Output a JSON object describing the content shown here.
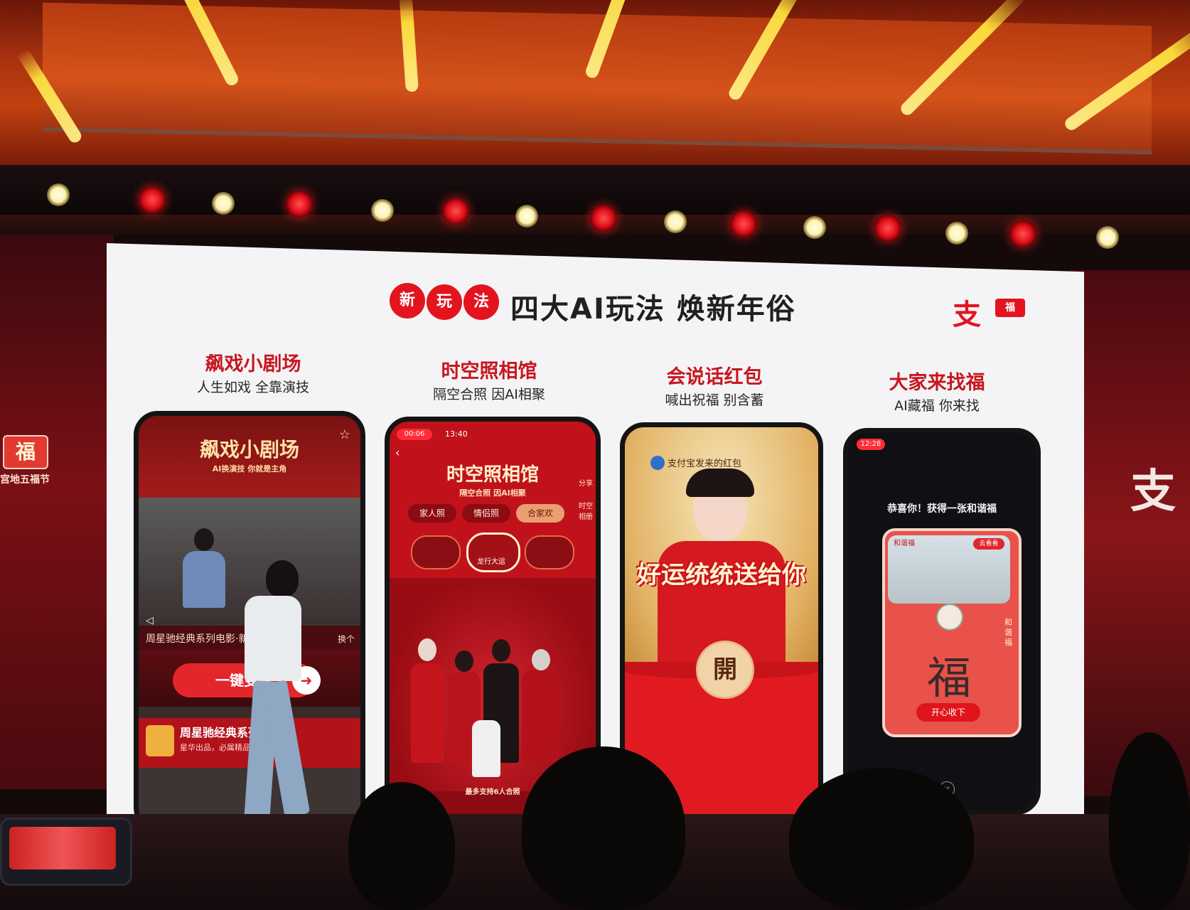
{
  "slide": {
    "badge_chars": [
      "新",
      "玩",
      "法"
    ],
    "title": "四大AI玩法  焕新年俗",
    "brand_mark": "支",
    "brand_mini": "福"
  },
  "columns": [
    {
      "title": "飙戏小剧场",
      "subtitle": "人生如戏 全靠演技",
      "phone": {
        "header": "飙戏小剧场",
        "tagline": "AI换演技 你就是主角",
        "caption": "周星驰经典系列电影·新",
        "swap": "换个",
        "cta": "一键变身",
        "card_title": "周星驰经典系列电",
        "card_sub": "星华出品，必属精品"
      }
    },
    {
      "title": "时空照相馆",
      "subtitle": "隔空合照 因AI相聚",
      "phone": {
        "time": "13:40",
        "rec": "00:06",
        "header": "时空照相馆",
        "tagline": "隔空合照 因AI相聚",
        "tabs": [
          "家人照",
          "情侣照",
          "合家欢"
        ],
        "thumb_label": "龙行大运",
        "side_label_1": "分享",
        "side_label_2": "时空相册",
        "footer": "最多支持6人合照"
      }
    },
    {
      "title": "会说话红包",
      "subtitle": "喊出祝福 别含蓄",
      "phone": {
        "sender": "支付宝发来的红包",
        "greeting": "好运统统送给你",
        "open_button": "開"
      }
    },
    {
      "title": "大家来找福",
      "subtitle": "AI藏福 你来找",
      "phone": {
        "time": "12:28",
        "headline": "恭喜你！获得一张和谐福",
        "card_top": "和谐福",
        "card_badge": "去看看",
        "card_char": "福",
        "side_text": "和谐福",
        "collect_button": "开心收下"
      }
    }
  ],
  "side_banners": {
    "left_logo": "福",
    "left_text": "宫地五福节",
    "right_mark": "支"
  }
}
